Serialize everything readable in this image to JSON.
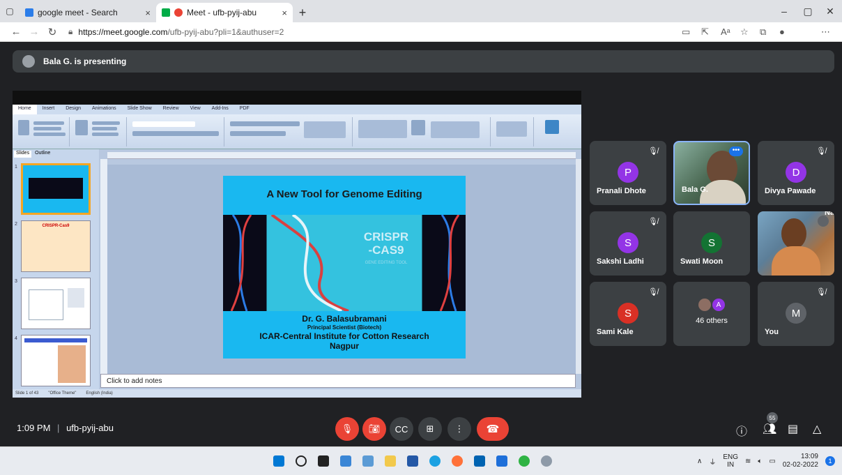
{
  "browser": {
    "tabs": [
      {
        "title": "google meet - Search",
        "close": "×"
      },
      {
        "title": "Meet - ufb-pyij-abu",
        "close": "×"
      }
    ],
    "new_tab": "+",
    "url_host": "https://meet.google.com",
    "url_path": "/ufb-pyij-abu?pli=1&authuser=2",
    "window_controls": [
      "–",
      "▢",
      "✕"
    ]
  },
  "meet": {
    "presenting_text": "Bala G. is presenting",
    "meeting_time": "1:09 PM",
    "meeting_code": "ufb-pyij-abu",
    "people_count": "55",
    "participants": [
      {
        "name": "Pranali Dhote",
        "initial": "P",
        "color": "#9334e6",
        "muted": true
      },
      {
        "name": "Bala G.",
        "initial": "",
        "color": "",
        "muted": false
      },
      {
        "name": "Divya Pawade",
        "initial": "D",
        "color": "#9334e6",
        "muted": true
      },
      {
        "name": "Sakshi Ladhi",
        "initial": "S",
        "color": "#9334e6",
        "muted": true
      },
      {
        "name": "Swati Moon",
        "initial": "S",
        "color": "#137333",
        "muted": false
      },
      {
        "name": "Nayana Shirbh...",
        "initial": "",
        "color": "",
        "muted": true
      },
      {
        "name": "Sami Kale",
        "initial": "S",
        "color": "#d93025",
        "muted": true
      },
      {
        "name": "46 others",
        "initial": "A",
        "color": "#9334e6",
        "muted": true
      },
      {
        "name": "You",
        "initial": "M",
        "color": "#5f6368",
        "muted": true
      }
    ]
  },
  "slide": {
    "title": "A New Tool for Genome Editing",
    "crispr_text": "CRISPR\n-CAS9",
    "crispr_line1": "CRISPR",
    "crispr_line2": "-CAS9",
    "edit_text": "GENE EDITING TOOL",
    "author": "Dr. G. Balasubramani",
    "role": "Principal Scientist (Biotech)",
    "institute": "ICAR-Central Institute for Cotton Research",
    "city": "Nagpur",
    "notes_placeholder": "Click to add notes",
    "thumb2_title": "CRISPR-Cas9",
    "ppt_tabs": [
      "Home",
      "Insert",
      "Design",
      "Animations",
      "Slide Show",
      "Review",
      "View",
      "Add-Ins",
      "PDF"
    ],
    "panel_tabs": [
      "Slides",
      "Outline"
    ],
    "status_slide": "Slide 1 of 43",
    "status_theme": "\"Office Theme\"",
    "status_lang": "English (India)"
  },
  "taskbar": {
    "lang": "ENG",
    "region": "IN",
    "time": "13:09",
    "date": "02-02-2022"
  },
  "colors": {
    "meet_bg": "#202124",
    "tile_bg": "#3c4043",
    "end_red": "#ea4335",
    "slide_blue": "#19b8f0"
  }
}
